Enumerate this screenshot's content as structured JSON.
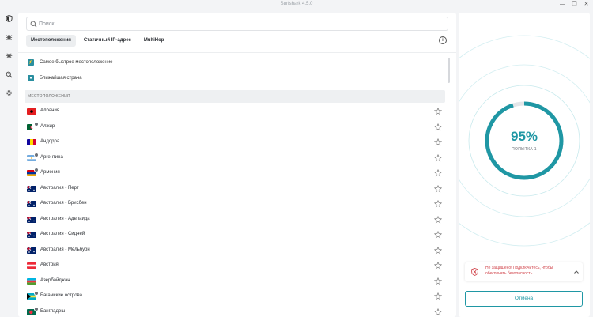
{
  "app": {
    "title": "Surfshark 4.5.0"
  },
  "window_controls": [
    "—",
    "❐",
    "✕"
  ],
  "sidebar": {
    "items": [
      {
        "name": "vpn",
        "icon": "shield-icon"
      },
      {
        "name": "antivirus",
        "icon": "bug-icon"
      },
      {
        "name": "alert",
        "icon": "virus-icon"
      },
      {
        "name": "search",
        "icon": "search-user-icon"
      },
      {
        "name": "settings",
        "icon": "gear-icon"
      }
    ]
  },
  "search": {
    "placeholder": "Поиск",
    "value": ""
  },
  "tabs": [
    {
      "label": "Местоположения",
      "active": true
    },
    {
      "label": "Статичный IP-адрес",
      "active": false
    },
    {
      "label": "MultiHop",
      "active": false
    }
  ],
  "quick_connect": [
    {
      "label": "Самое быстрое местоположение",
      "icon": "lightning-icon"
    },
    {
      "label": "Ближайшая страна",
      "icon": "location-icon"
    }
  ],
  "section_header": "МЕСТОПОЛОЖЕНИЯ",
  "locations": [
    {
      "name": "Албания",
      "flag": "al",
      "virtual": false
    },
    {
      "name": "Алжир",
      "flag": "dz",
      "virtual": true
    },
    {
      "name": "Андорра",
      "flag": "ad",
      "virtual": false
    },
    {
      "name": "Аргентина",
      "flag": "ar",
      "virtual": true
    },
    {
      "name": "Армения",
      "flag": "am",
      "virtual": true
    },
    {
      "name": "Австралия - Перт",
      "flag": "au",
      "virtual": false
    },
    {
      "name": "Австралия - Брисбен",
      "flag": "au",
      "virtual": false
    },
    {
      "name": "Австралия - Аделаида",
      "flag": "au",
      "virtual": false
    },
    {
      "name": "Австралия - Сидней",
      "flag": "au",
      "virtual": false
    },
    {
      "name": "Австралия - Мельбурн",
      "flag": "au",
      "virtual": false
    },
    {
      "name": "Австрия",
      "flag": "at",
      "virtual": false
    },
    {
      "name": "Азербайджан",
      "flag": "az",
      "virtual": false
    },
    {
      "name": "Багамские острова",
      "flag": "bs",
      "virtual": true
    },
    {
      "name": "Бангладеш",
      "flag": "bd",
      "virtual": true
    }
  ],
  "connection": {
    "percent": "95%",
    "progress": 0.95,
    "attempt": "ПОПЫТКА 1"
  },
  "alert": {
    "message": "Не защищено! Подключитесь, чтобы обеспечить безопасность."
  },
  "cancel_button": "Отмена",
  "colors": {
    "accent": "#1f97a4",
    "danger": "#d0434a",
    "ring_track": "#e4e6e9"
  }
}
